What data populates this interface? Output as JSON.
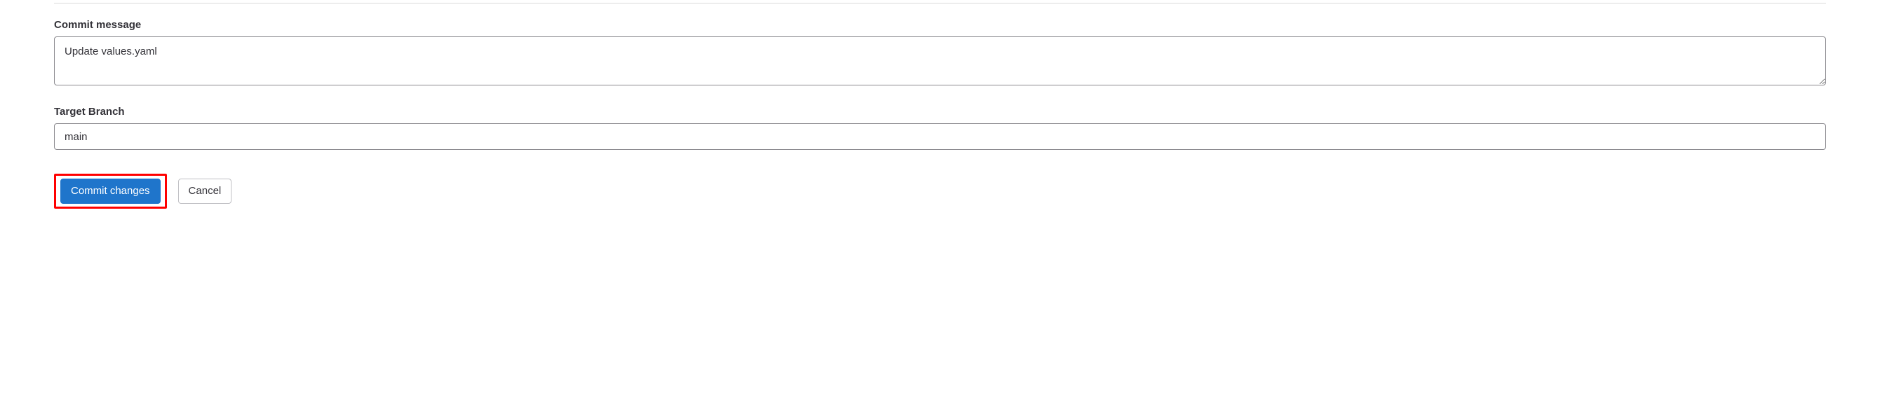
{
  "commit": {
    "message_label": "Commit message",
    "message_value": "Update values.yaml",
    "branch_label": "Target Branch",
    "branch_value": "main"
  },
  "buttons": {
    "commit_label": "Commit changes",
    "cancel_label": "Cancel"
  }
}
